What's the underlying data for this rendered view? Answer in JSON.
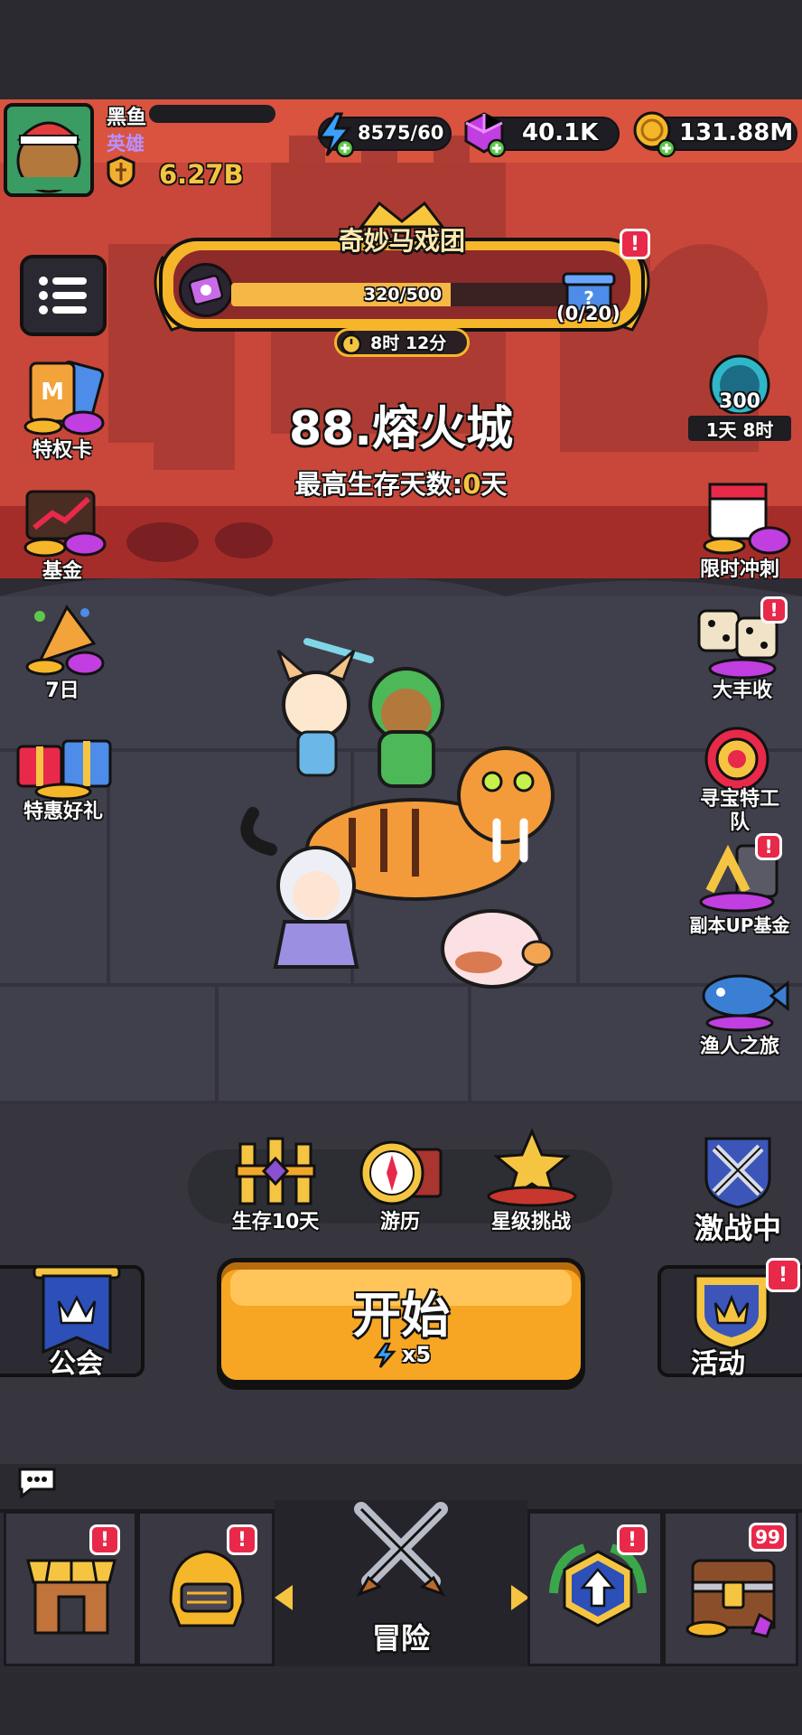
{
  "player": {
    "name": "黑鱼",
    "rank": "英雄",
    "power": "6.27B"
  },
  "resources": {
    "energy": "8575/60",
    "gems": "40.1K",
    "gold": "131.88M"
  },
  "event": {
    "title": "奇妙马戏团",
    "progress_text": "320/500",
    "progress": 0.64,
    "reward_count": "(0/20)",
    "timer": "8时 12分"
  },
  "stage": {
    "title": "88.熔火城",
    "subtitle_prefix": "最高生存天数:",
    "subtitle_value": "0",
    "subtitle_suffix": "天"
  },
  "left_side": [
    {
      "label": "特权卡"
    },
    {
      "label": "基金"
    },
    {
      "label": "7日"
    },
    {
      "label": "特惠好礼"
    }
  ],
  "right_side": {
    "season": {
      "value": "300",
      "timer": "1天 8时"
    },
    "items": [
      {
        "label": "限时冲刺"
      },
      {
        "label": "大丰收"
      },
      {
        "label": "寻宝特工"
      },
      {
        "label": "队"
      },
      {
        "label": "副本UP基金"
      },
      {
        "label": "渔人之旅"
      }
    ]
  },
  "modes": [
    {
      "label": "生存10天"
    },
    {
      "label": "游历"
    },
    {
      "label": "星级挑战"
    }
  ],
  "battle": {
    "label": "激战中"
  },
  "guild": {
    "label": "公会"
  },
  "start": {
    "label": "开始",
    "cost": "x5"
  },
  "activity": {
    "label": "活动"
  },
  "badge_mark": "!",
  "bottom_nav": {
    "adventure_label": "冒险",
    "chest_count": "99"
  },
  "colors": {
    "accent_orange": "#f7a623",
    "red_badge": "#e8294a",
    "gold": "#f5c542",
    "lava": "#b8352e"
  }
}
